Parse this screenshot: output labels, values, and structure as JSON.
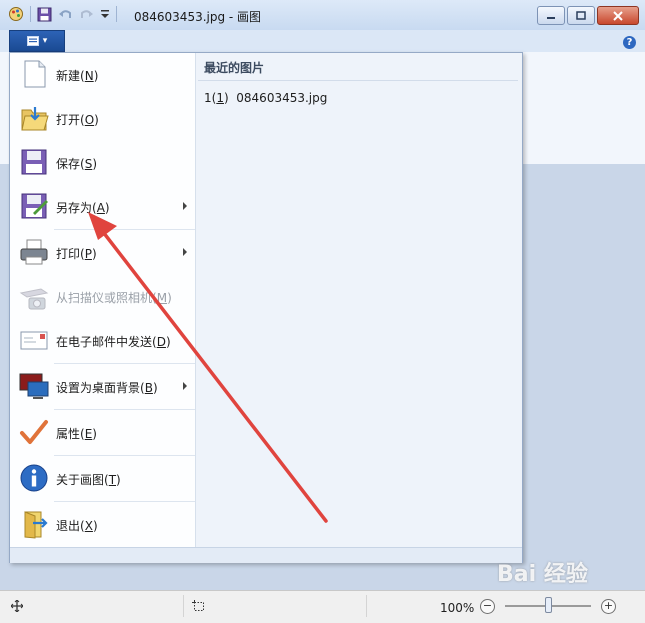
{
  "window": {
    "title": "084603453.jpg - 画图",
    "help_glyph": "?"
  },
  "file_tab": {
    "glyph": "▾"
  },
  "menu": {
    "items": [
      {
        "label": "新建",
        "key": "N",
        "icon": "new-file-icon",
        "submenu": false,
        "disabled": false
      },
      {
        "label": "打开",
        "key": "O",
        "icon": "open-folder-icon",
        "submenu": false,
        "disabled": false
      },
      {
        "label": "保存",
        "key": "S",
        "icon": "save-icon",
        "submenu": false,
        "disabled": false
      },
      {
        "label": "另存为",
        "key": "A",
        "icon": "save-as-icon",
        "submenu": true,
        "disabled": false
      },
      {
        "label": "打印",
        "key": "P",
        "icon": "printer-icon",
        "submenu": true,
        "disabled": false
      },
      {
        "label": "从扫描仪或照相机",
        "key": "M",
        "icon": "scanner-icon",
        "submenu": false,
        "disabled": true
      },
      {
        "label": "在电子邮件中发送",
        "key": "D",
        "icon": "email-icon",
        "submenu": false,
        "disabled": false
      },
      {
        "label": "设置为桌面背景",
        "key": "B",
        "icon": "desktop-background-icon",
        "submenu": true,
        "disabled": false
      },
      {
        "label": "属性",
        "key": "E",
        "icon": "checkmark-icon",
        "submenu": false,
        "disabled": false
      },
      {
        "label": "关于画图",
        "key": "T",
        "icon": "info-icon",
        "submenu": false,
        "disabled": false
      },
      {
        "label": "退出",
        "key": "X",
        "icon": "exit-icon",
        "submenu": false,
        "disabled": false
      }
    ],
    "recent": {
      "title": "最近的图片",
      "items": [
        {
          "num": "1",
          "key": "1",
          "name": "084603453.jpg"
        }
      ]
    }
  },
  "statusbar": {
    "zoom": "100%",
    "zoom_level_fraction": 0.5,
    "zoom_out": "−",
    "zoom_in": "+"
  },
  "watermark": "Bai 经验"
}
